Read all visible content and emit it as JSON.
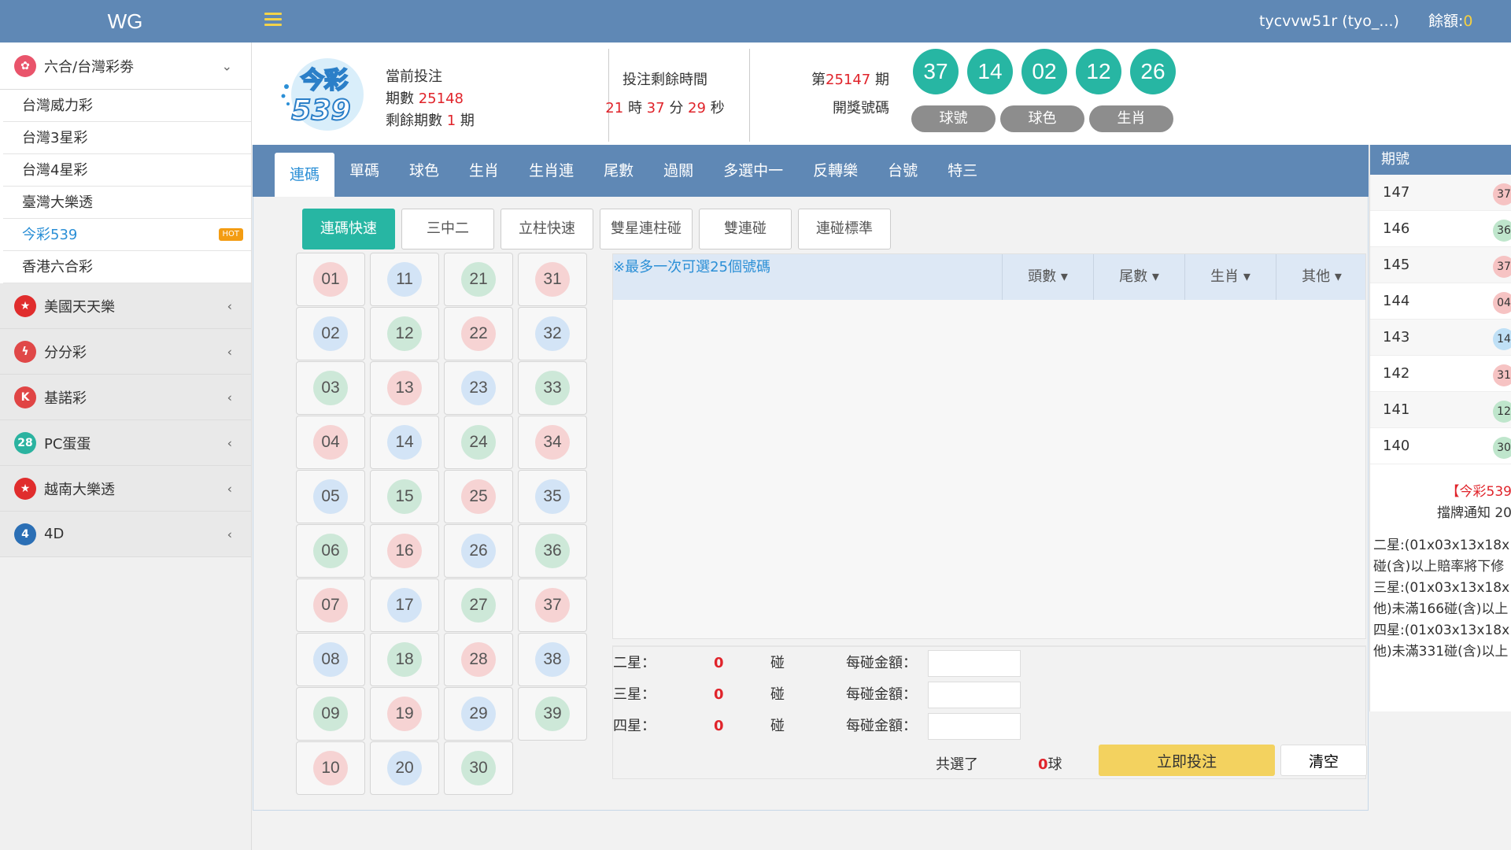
{
  "topbar": {
    "brand": "WG",
    "username": "tycvvw51r (tyo_...)",
    "balance_label": "餘額:",
    "balance_value": "0"
  },
  "sidebar": {
    "categories": [
      {
        "label": "六合/台灣彩劵",
        "icon": "lotto-icon",
        "color": "#e9546b",
        "open": true,
        "items": [
          {
            "label": "台灣威力彩"
          },
          {
            "label": "台灣3星彩"
          },
          {
            "label": "台灣4星彩"
          },
          {
            "label": "臺灣大樂透"
          },
          {
            "label": "今彩539",
            "active": true,
            "badge": "HOT"
          },
          {
            "label": "香港六合彩"
          }
        ]
      },
      {
        "label": "美國天天樂",
        "icon": "star-icon",
        "color": "#e02d2d"
      },
      {
        "label": "分分彩",
        "icon": "bolt-icon",
        "color": "#e04848"
      },
      {
        "label": "基諾彩",
        "icon": "k-icon",
        "color": "#e04545",
        "glyph": "K"
      },
      {
        "label": "PC蛋蛋",
        "icon": "pc28-icon",
        "color": "#2bb3a0",
        "glyph": "28"
      },
      {
        "label": "越南大樂透",
        "icon": "vn-star-icon",
        "color": "#e02d2d"
      },
      {
        "label": "4D",
        "icon": "4d-icon",
        "color": "#2b6fb5",
        "glyph": "4"
      }
    ]
  },
  "header": {
    "logo": {
      "text1": "今彩",
      "text2": "539"
    },
    "current_label": "當前投注",
    "issue_label": "期數",
    "issue_value": "25148",
    "remaining_issues_label": "剩餘期數",
    "remaining_issues_value": "1",
    "remaining_issues_unit": "期",
    "countdown_title": "投注剩餘時間",
    "countdown": {
      "h": "21",
      "h_unit": "時",
      "m": "37",
      "m_unit": "分",
      "s": "29",
      "s_unit": "秒"
    },
    "draw_prefix": "第",
    "draw_issue": "25147",
    "draw_suffix": "期",
    "draw_label": "開獎號碼",
    "balls": [
      "37",
      "14",
      "02",
      "12",
      "26"
    ],
    "ball_color": "#27b6a3",
    "pills": [
      "球號",
      "球色",
      "生肖"
    ]
  },
  "tabs": [
    "連碼",
    "單碼",
    "球色",
    "生肖",
    "生肖連",
    "尾數",
    "過關",
    "多選中一",
    "反轉樂",
    "台號",
    "特三"
  ],
  "subtabs": [
    "連碼快速",
    "三中二",
    "立柱快速",
    "雙星連柱碰",
    "雙連碰",
    "連碰標準"
  ],
  "numbers": [
    [
      "01",
      "r"
    ],
    [
      "11",
      "b"
    ],
    [
      "21",
      "g"
    ],
    [
      "31",
      "r"
    ],
    [
      "02",
      "b"
    ],
    [
      "12",
      "g"
    ],
    [
      "22",
      "r"
    ],
    [
      "32",
      "b"
    ],
    [
      "03",
      "g"
    ],
    [
      "13",
      "r"
    ],
    [
      "23",
      "b"
    ],
    [
      "33",
      "g"
    ],
    [
      "04",
      "r"
    ],
    [
      "14",
      "b"
    ],
    [
      "24",
      "g"
    ],
    [
      "34",
      "r"
    ],
    [
      "05",
      "b"
    ],
    [
      "15",
      "g"
    ],
    [
      "25",
      "r"
    ],
    [
      "35",
      "b"
    ],
    [
      "06",
      "g"
    ],
    [
      "16",
      "r"
    ],
    [
      "26",
      "b"
    ],
    [
      "36",
      "g"
    ],
    [
      "07",
      "r"
    ],
    [
      "17",
      "b"
    ],
    [
      "27",
      "g"
    ],
    [
      "37",
      "r"
    ],
    [
      "08",
      "b"
    ],
    [
      "18",
      "g"
    ],
    [
      "28",
      "r"
    ],
    [
      "38",
      "b"
    ],
    [
      "09",
      "g"
    ],
    [
      "19",
      "r"
    ],
    [
      "29",
      "b"
    ],
    [
      "39",
      "g"
    ],
    [
      "10",
      "r"
    ],
    [
      "20",
      "b"
    ],
    [
      "30",
      "g"
    ]
  ],
  "panel": {
    "note": "※最多一次可選25個號碼",
    "dropdowns": [
      "頭數",
      "尾數",
      "生肖",
      "其他"
    ]
  },
  "summary": {
    "rows": [
      {
        "label": "二星：",
        "count": "0",
        "unit": "碰",
        "amount_label": "每碰金額："
      },
      {
        "label": "三星：",
        "count": "0",
        "unit": "碰",
        "amount_label": "每碰金額："
      },
      {
        "label": "四星：",
        "count": "0",
        "unit": "碰",
        "amount_label": "每碰金額："
      }
    ],
    "total_label": "共選了",
    "total_value": "0",
    "total_unit": "球",
    "submit_label": "立即投注",
    "clear_label": "清空"
  },
  "results": {
    "header": "期號",
    "rows": [
      {
        "issue": "147",
        "first": "37",
        "color": "#f6c3c3"
      },
      {
        "issue": "146",
        "first": "36",
        "color": "#bfe6cc"
      },
      {
        "issue": "145",
        "first": "37",
        "color": "#f6c3c3"
      },
      {
        "issue": "144",
        "first": "04",
        "color": "#f6c3c3"
      },
      {
        "issue": "143",
        "first": "14",
        "color": "#bfe0f6"
      },
      {
        "issue": "142",
        "first": "31",
        "color": "#f6c3c3"
      },
      {
        "issue": "141",
        "first": "12",
        "color": "#bfe6cc"
      },
      {
        "issue": "140",
        "first": "30",
        "color": "#bfe6cc"
      }
    ],
    "notice_title": "【今彩539",
    "notice_sub": "擋牌通知 20",
    "notice_lines": [
      "二星:(01x03x13x18x",
      "碰(含)以上賠率將下修",
      "三星:(01x03x13x18x",
      "他)未滿166碰(含)以上",
      "四星:(01x03x13x18x",
      "他)未滿331碰(含)以上"
    ]
  }
}
